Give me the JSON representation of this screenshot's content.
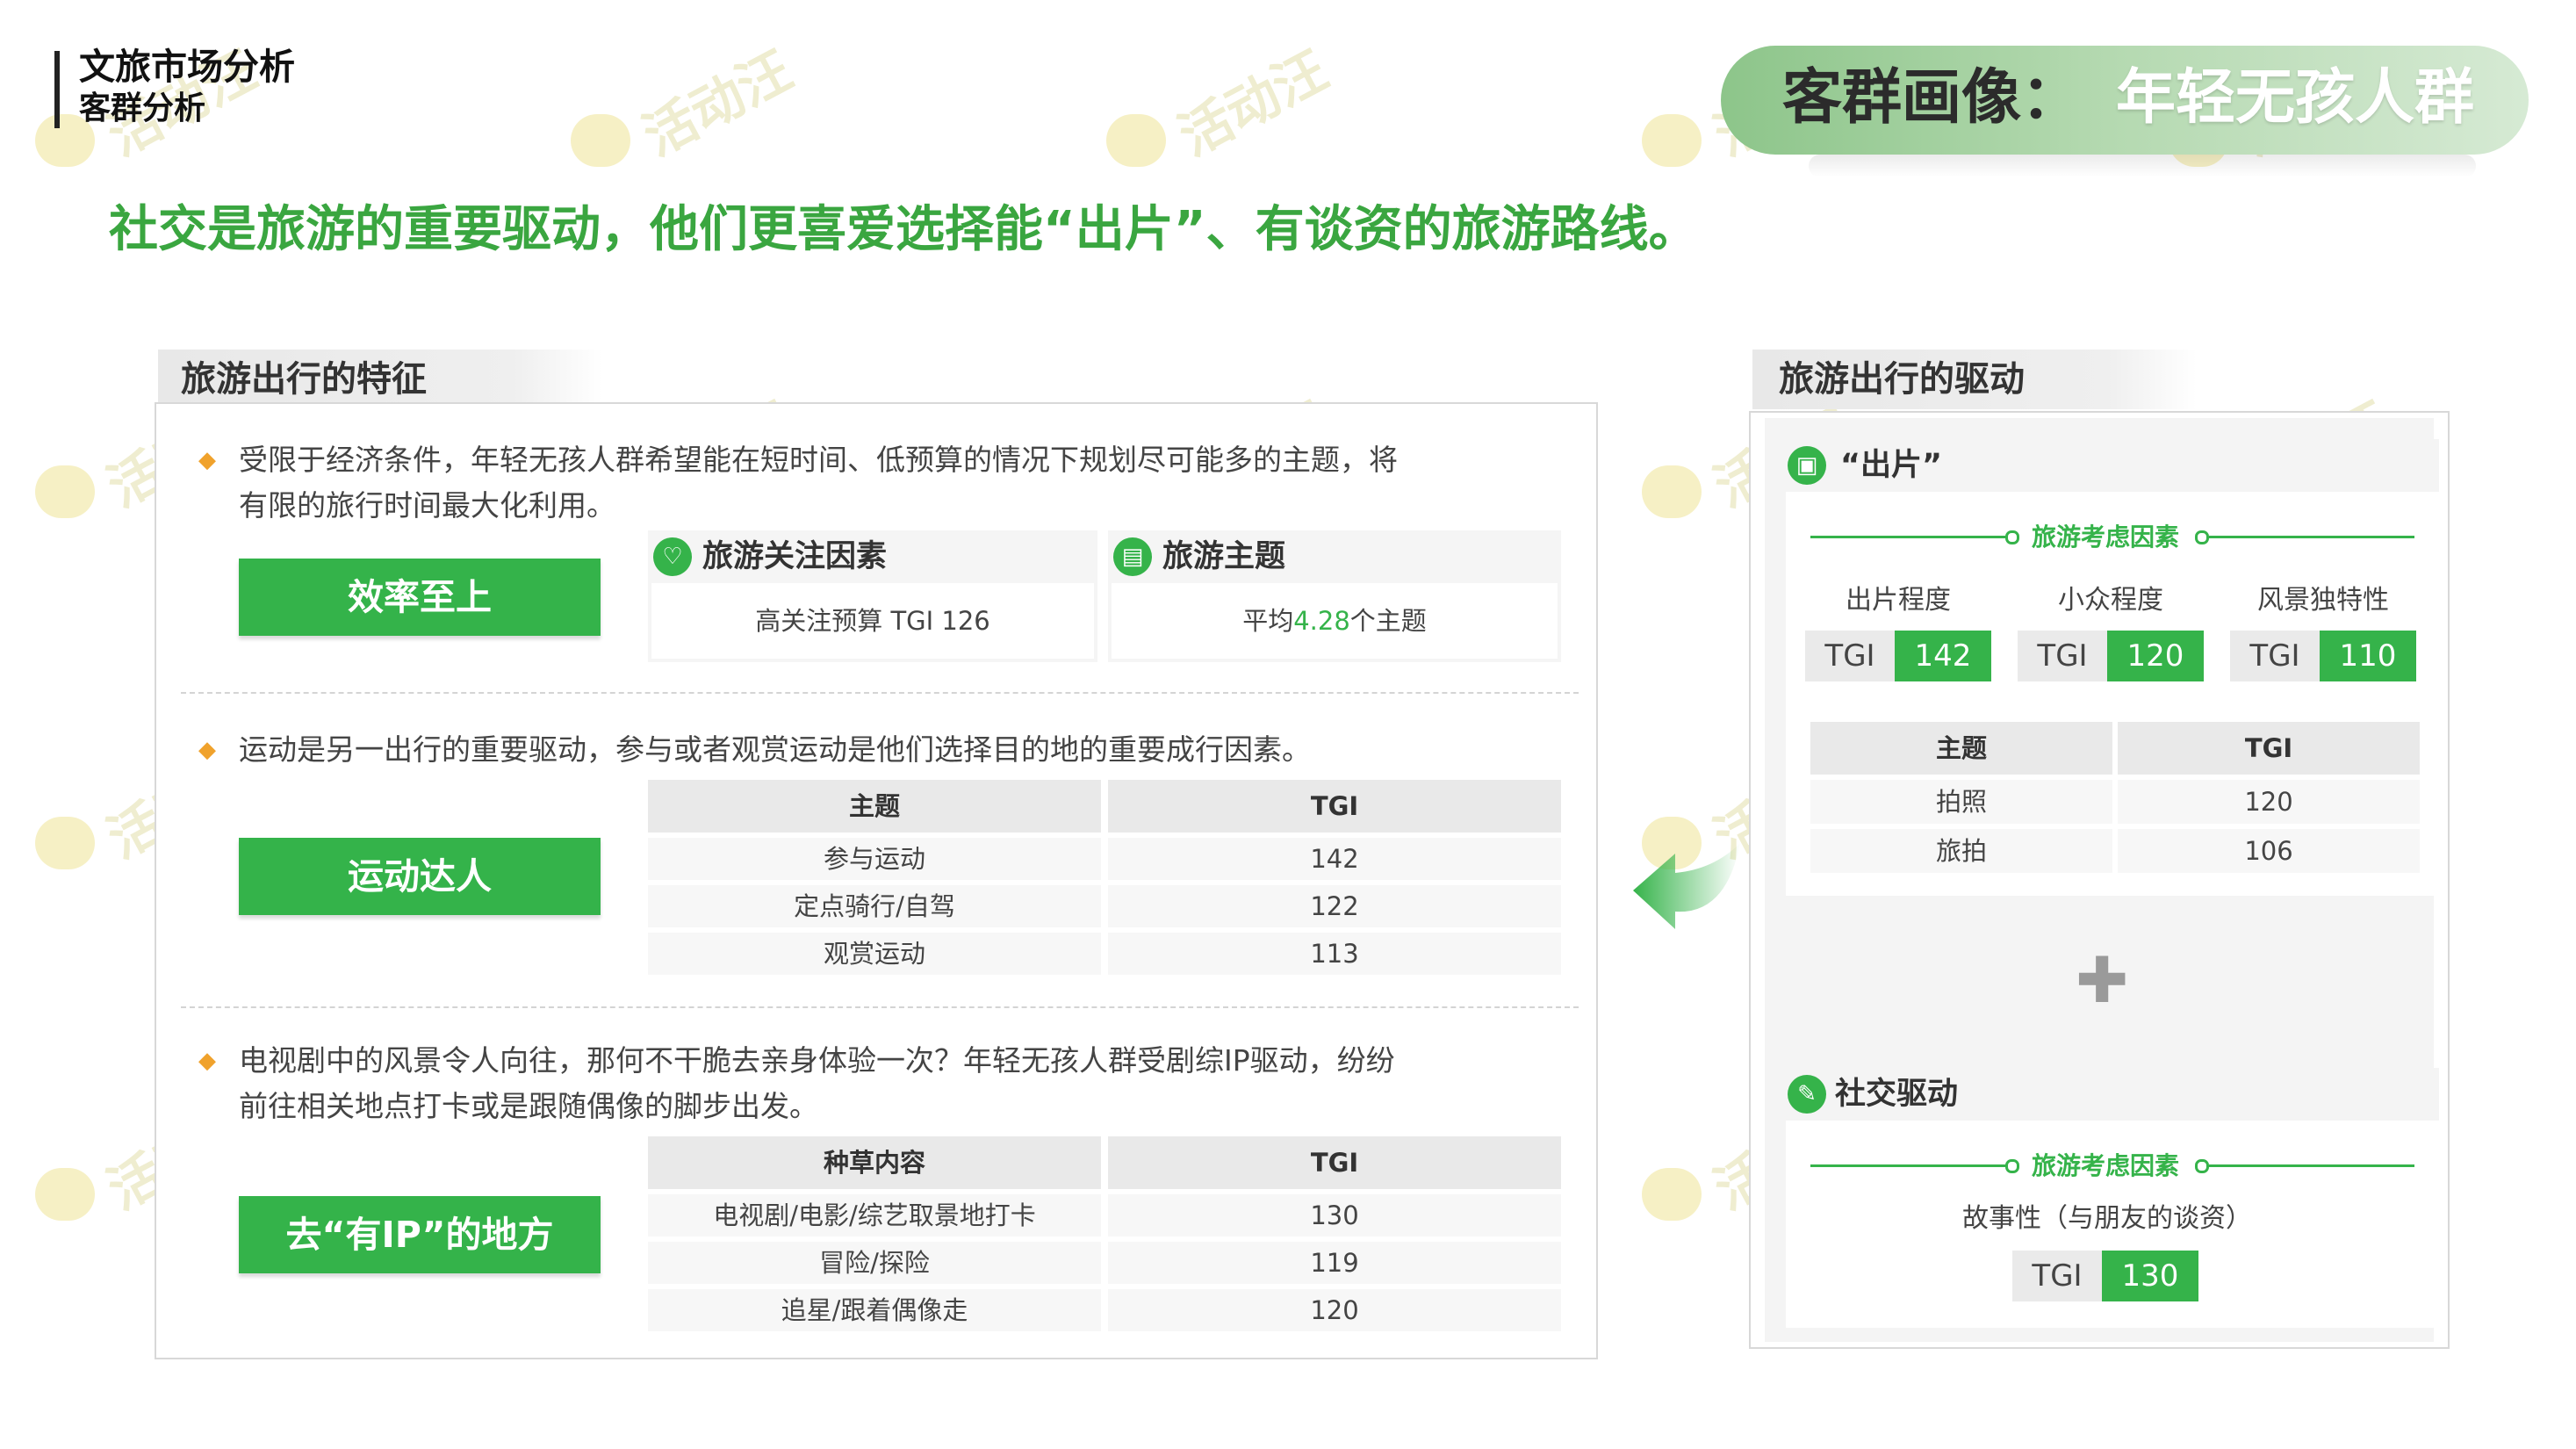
{
  "header": {
    "title": "文旅市场分析",
    "subtitle": "客群分析",
    "badge_title": "客群画像：",
    "badge_highlight": "年轻无孩人群",
    "headline": "社交是旅游的重要驱动，他们更喜爱选择能“出片”、有谈资的旅游路线。"
  },
  "watermark": "活动汪",
  "left_panel": {
    "tab": "旅游出行的特征",
    "section1": {
      "text_line1": "受限于经济条件，年轻无孩人群希望能在短时间、低预算的情况下规划尽可能多的主题，将",
      "text_line2": "有限的旅行时间最大化利用。",
      "button": "效率至上",
      "factor_title": "旅游关注因素",
      "factor_value": "高关注预算 TGI 126",
      "theme_title": "旅游主题",
      "theme_value_pre": "平均",
      "theme_value_num": "4.28",
      "theme_value_post": "个主题"
    },
    "section2": {
      "text": "运动是另一出行的重要驱动，参与或者观赏运动是他们选择目的地的重要成行因素。",
      "button": "运动达人",
      "columns": [
        "主题",
        "TGI"
      ],
      "rows": [
        [
          "参与运动",
          "142"
        ],
        [
          "定点骑行/自驾",
          "122"
        ],
        [
          "观赏运动",
          "113"
        ]
      ]
    },
    "section3": {
      "text_line1": "电视剧中的风景令人向往，那何不干脆去亲身体验一次？年轻无孩人群受剧综IP驱动，纷纷",
      "text_line2": "前往相关地点打卡或是跟随偶像的脚步出发。",
      "button": "去“有IP”的地方",
      "columns": [
        "种草内容",
        "TGI"
      ],
      "rows": [
        [
          "电视剧/电影/综艺取景地打卡",
          "130"
        ],
        [
          "冒险/探险",
          "119"
        ],
        [
          "追星/跟着偶像走",
          "120"
        ]
      ]
    }
  },
  "right_panel": {
    "tab": "旅游出行的驱动",
    "card1": {
      "title": "“出片”",
      "factor_label": "旅游考虑因素",
      "metrics": [
        {
          "label": "出片程度",
          "tgi_label": "TGI",
          "value": "142"
        },
        {
          "label": "小众程度",
          "tgi_label": "TGI",
          "value": "120"
        },
        {
          "label": "风景独特性",
          "tgi_label": "TGI",
          "value": "110"
        }
      ],
      "columns": [
        "主题",
        "TGI"
      ],
      "rows": [
        [
          "拍照",
          "120"
        ],
        [
          "旅拍",
          "106"
        ]
      ]
    },
    "plus": "✚",
    "card2": {
      "title": "社交驱动",
      "factor_label": "旅游考虑因素",
      "metric_label": "故事性（与朋友的谈资）",
      "tgi_label": "TGI",
      "value": "130"
    }
  },
  "colors": {
    "accent": "#35b34a",
    "headline": "#3aa640",
    "bullet": "#f0a22c"
  },
  "icons": {
    "bullet": "diamond-bullet-icon",
    "factor": "heart-check-icon",
    "theme": "document-icon",
    "photo": "image-icon",
    "social": "chat-icon",
    "arrow": "curved-arrow-left-icon"
  }
}
